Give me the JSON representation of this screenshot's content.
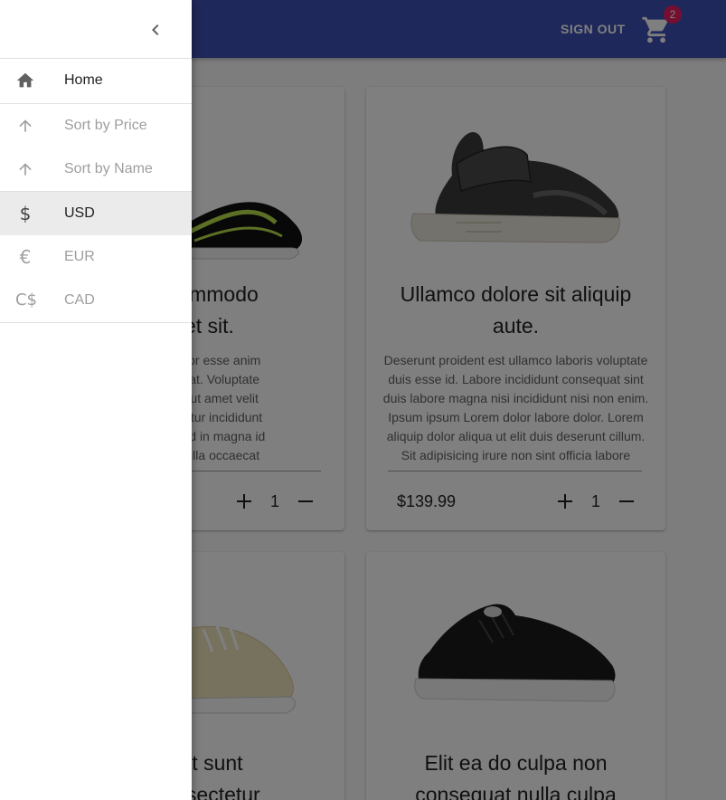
{
  "header": {
    "signout_label": "SIGN OUT",
    "cart_count": "2",
    "color": "#3f51b5",
    "badge_color": "#e91e63"
  },
  "drawer": {
    "items": [
      {
        "label": "Home",
        "icon": "home-icon"
      },
      {
        "label": "Sort by Price",
        "icon": "arrow-up-icon"
      },
      {
        "label": "Sort by Name",
        "icon": "arrow-up-icon"
      },
      {
        "label": "USD",
        "icon": "dollar-icon",
        "selected": true
      },
      {
        "label": "EUR",
        "icon": "euro-icon"
      },
      {
        "label": "CAD",
        "icon": "cad-icon"
      }
    ]
  },
  "products": [
    {
      "title": "ore commodo amet sit.",
      "title_lines": [
        "ore commodo",
        "amet sit."
      ],
      "description_lines": [
        "n qui tempor esse anim",
        "labore fugiat. Voluptate",
        "usmod do ut amet velit",
        "is consectetur incididunt",
        "na veniam id in magna id",
        "nsequat nulla occaecat"
      ],
      "price": "",
      "qty": "1"
    },
    {
      "title": "Ullamco dolore sit aliquip aute.",
      "title_lines": [
        "Ullamco dolore sit aliquip",
        "aute."
      ],
      "description_lines": [
        "Deserunt proident est ullamco laboris voluptate",
        "duis esse id. Labore incididunt consequat sint",
        "duis labore magna nisi incididunt nisi non enim.",
        "Ipsum ipsum Lorem dolor labore dolor. Lorem",
        "aliquip dolor aliqua ut elit duis deserunt cillum.",
        "Sit adipisicing irure non sint officia labore"
      ],
      "price": "$139.99",
      "qty": "1"
    },
    {
      "title_lines": [
        "aecat sunt",
        "m consectetur"
      ]
    },
    {
      "title_lines": [
        "Elit ea do culpa non",
        "consequat nulla culpa"
      ]
    }
  ]
}
